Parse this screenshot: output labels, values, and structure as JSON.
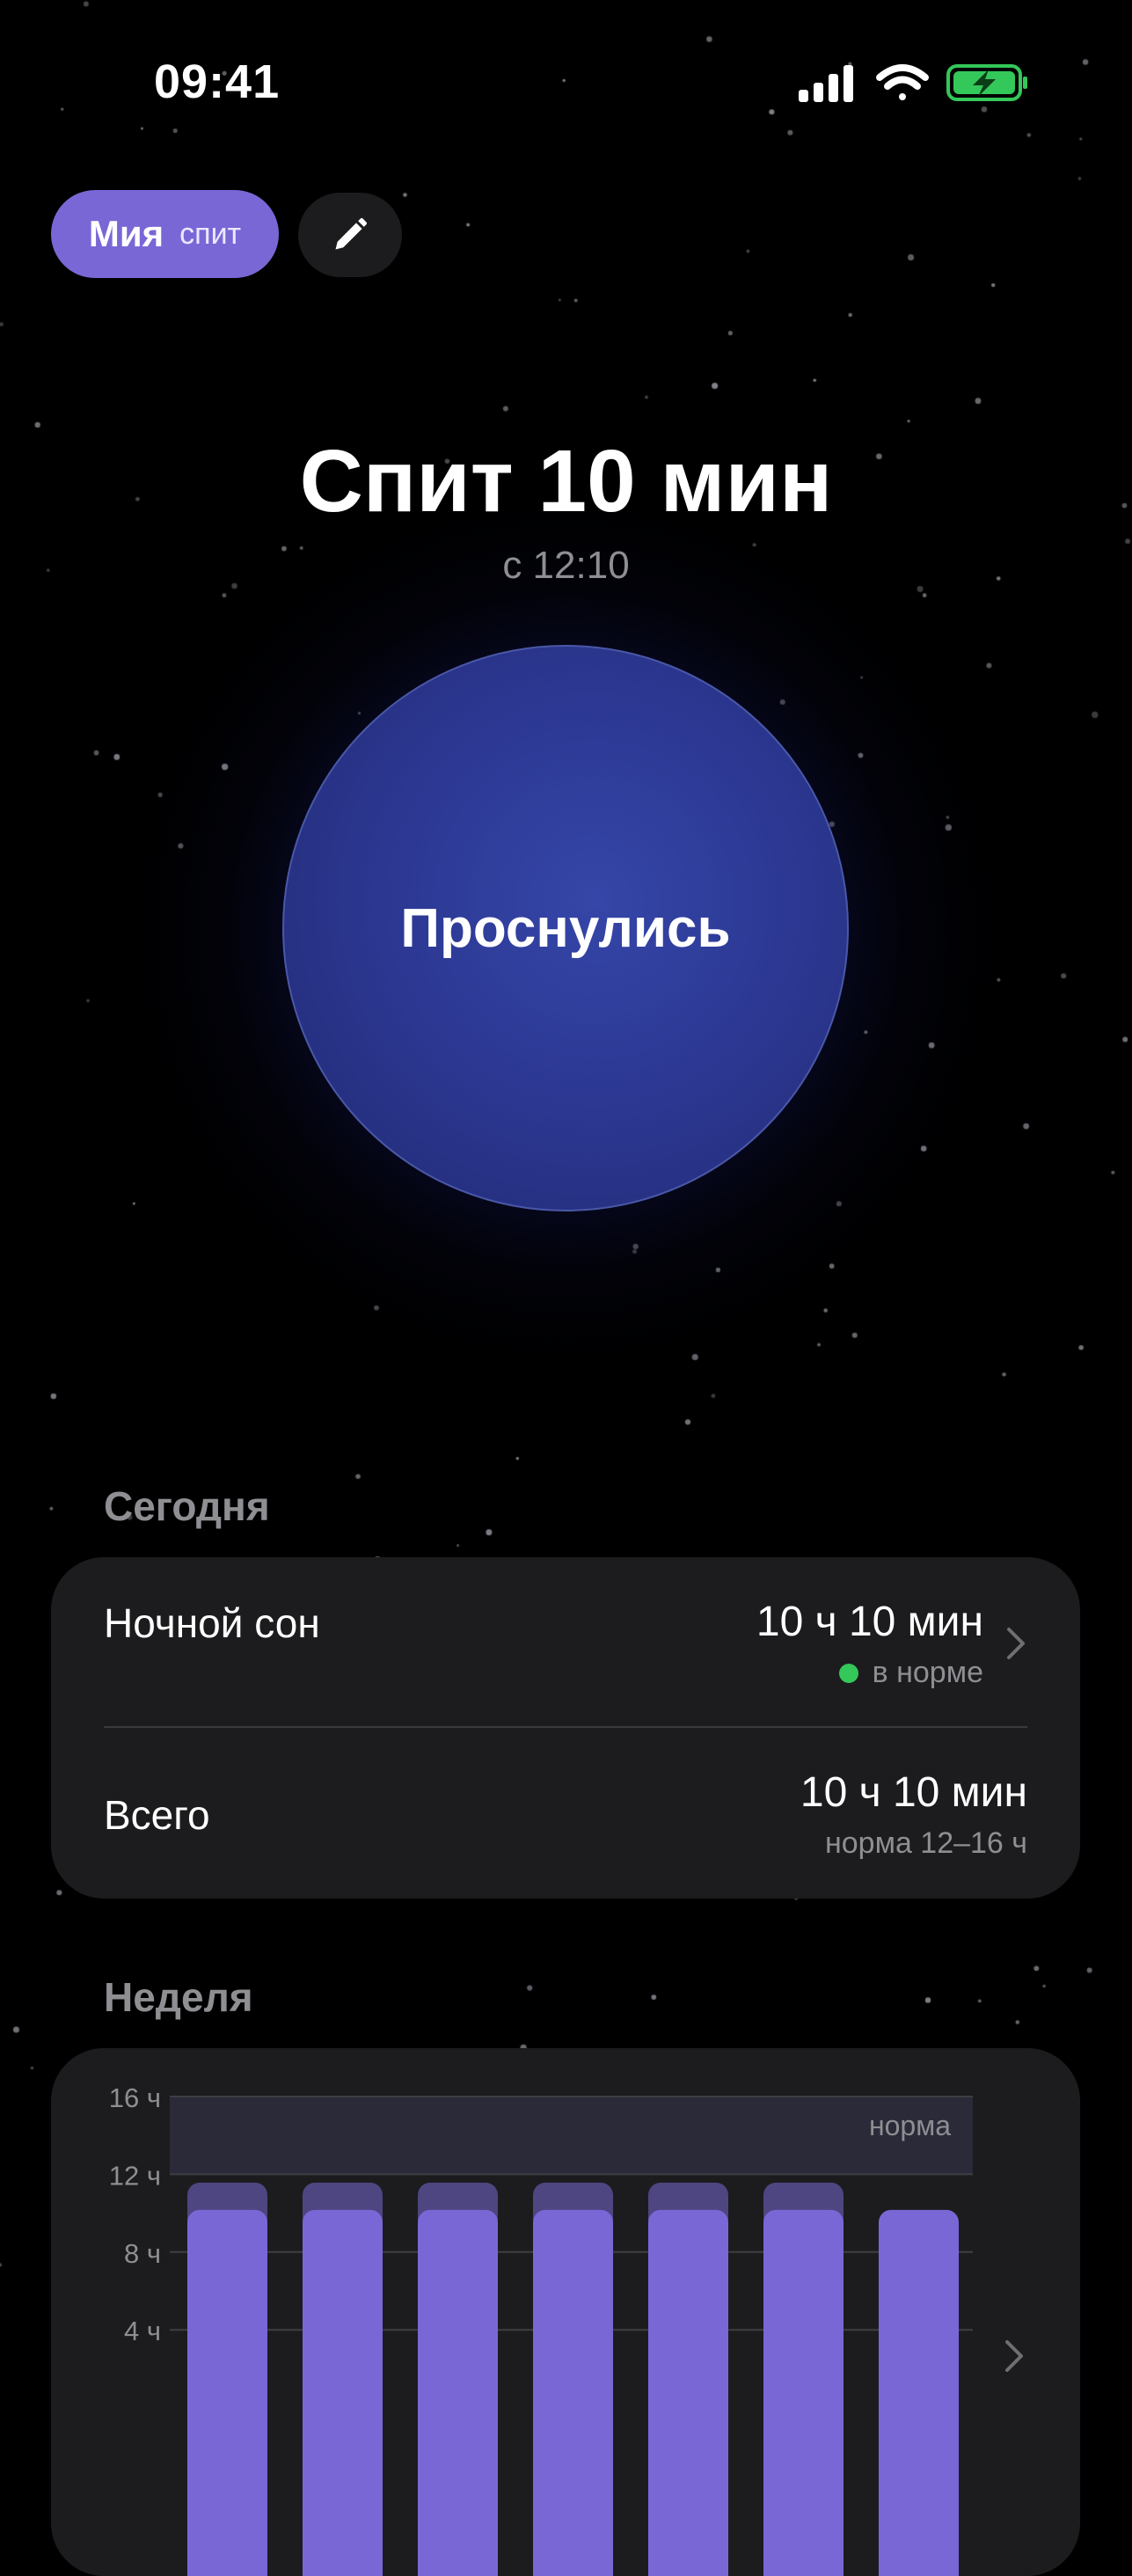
{
  "status_bar": {
    "time": "09:41",
    "icons": [
      "cellular-signal-icon",
      "wifi-icon",
      "battery-charging-icon"
    ],
    "battery_color": "#34C759"
  },
  "child": {
    "name": "Мия",
    "state": "спит",
    "accent_color": "#7A67D6"
  },
  "edit": {
    "icon": "pencil-icon"
  },
  "sleep": {
    "headline": "Спит 10 мин",
    "since": "с 12:10",
    "wake_button_label": "Проснулись"
  },
  "today": {
    "title": "Сегодня",
    "night": {
      "label": "Ночной сон",
      "value": "10 ч 10 мин",
      "status": "в норме",
      "status_color": "#34C759"
    },
    "total": {
      "label": "Всего",
      "value": "10 ч 10 мин",
      "norm": "норма 12–16 ч"
    }
  },
  "week": {
    "title": "Неделя",
    "chart_data": {
      "type": "bar",
      "ylim": [
        0,
        16
      ],
      "y_ticks": [
        {
          "value": 16,
          "label": "16 ч"
        },
        {
          "value": 12,
          "label": "12 ч"
        },
        {
          "value": 8,
          "label": "8 ч"
        },
        {
          "value": 4,
          "label": "4 ч"
        }
      ],
      "norm_band": {
        "from": 12,
        "to": 16,
        "label": "норма"
      },
      "series": [
        {
          "values": [
            10.17,
            10.17,
            10.17,
            10.17,
            10.17,
            10.17,
            10.17
          ],
          "color": "#7A67D6"
        },
        {
          "values": [
            1.4,
            1.4,
            1.4,
            1.4,
            1.4,
            1.4,
            0
          ],
          "color": "#4E4680"
        }
      ],
      "grid": true
    }
  }
}
